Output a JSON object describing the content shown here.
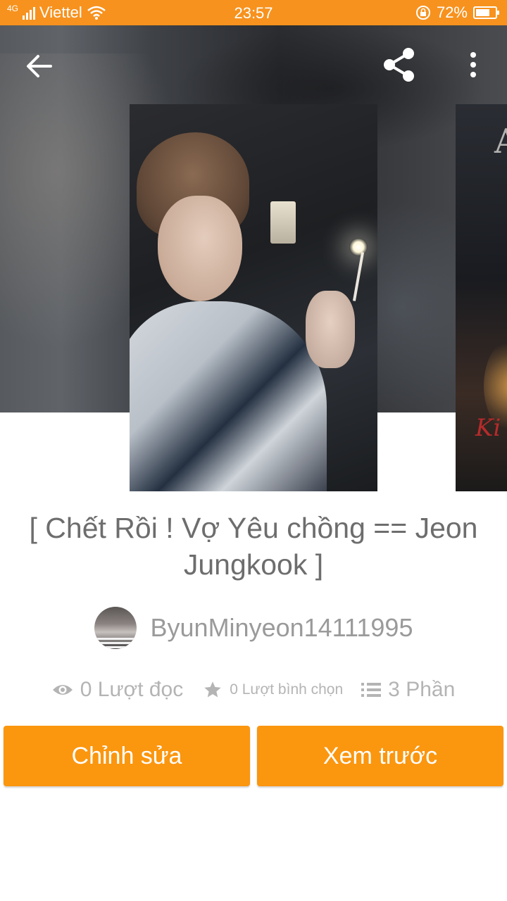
{
  "status_bar": {
    "network": "4G",
    "carrier": "Viettel",
    "time": "23:57",
    "battery_percent": "72%",
    "battery_level": 0.72
  },
  "header": {
    "back_icon": "arrow-left-icon",
    "share_icon": "share-icon",
    "more_icon": "more-vertical-icon"
  },
  "story": {
    "title": "[ Chết Rồi ! Vợ Yêu chồng == Jeon Jungkook ]",
    "author": "ByunMinyeon14111995",
    "stats": {
      "reads": "0 Lượt đọc",
      "votes": "0 Lượt bình chọn",
      "parts": "3 Phần"
    }
  },
  "actions": {
    "edit_label": "Chỉnh sửa",
    "preview_label": "Xem trước"
  },
  "colors": {
    "accent": "#fb960f",
    "status_bar": "#f7921e",
    "title_text": "#6d6d6d",
    "muted_text": "#b4b4b4"
  }
}
